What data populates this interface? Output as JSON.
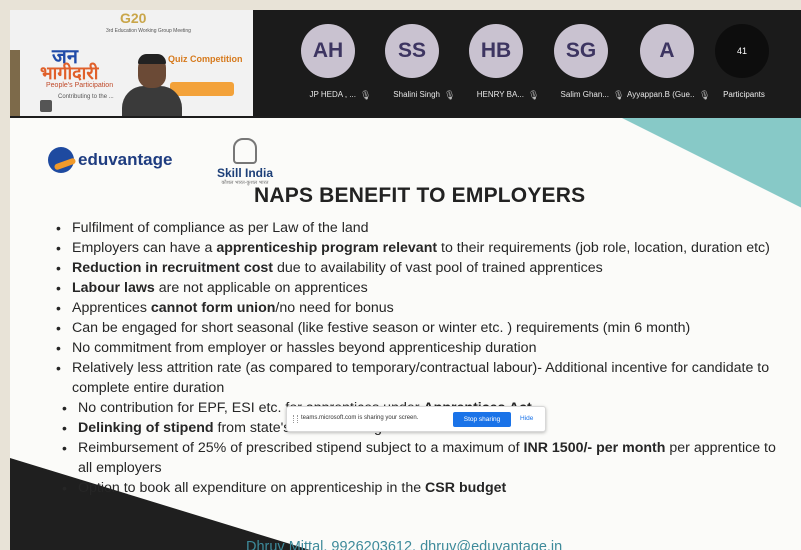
{
  "call": {
    "speaker_tile": {
      "g20_text": "G20",
      "sub_text": "3rd Education Working Group Meeting",
      "jan_text": "जन",
      "bhagidari_text": "भागीदारी",
      "participation_text": "People's Participation",
      "contributing_text": "Contributing to the ...",
      "quiz_text": "Quiz Competition"
    },
    "participants": [
      {
        "initials": "AH",
        "name": "JP HEDA , ..."
      },
      {
        "initials": "SS",
        "name": "Shalini Singh"
      },
      {
        "initials": "HB",
        "name": "HENRY BA..."
      },
      {
        "initials": "SG",
        "name": "Salim Ghan..."
      },
      {
        "initials": "A",
        "name": "Ayyappan.B (Gue..."
      }
    ],
    "participant_count": "41",
    "participants_label": "Participants",
    "mic_glyph": "🎙"
  },
  "slide": {
    "logo_text": "eduvantage",
    "skill_india": {
      "name": "Skill India",
      "tagline": "कौशल भारत-कुशल भारत"
    },
    "title": "NAPS BENEFIT TO EMPLOYERS",
    "bullets": [
      {
        "pre": "Fulfilment of compliance as per Law of the land",
        "bold": "",
        "post": ""
      },
      {
        "pre": "Employers can have a ",
        "bold": "apprenticeship program relevant",
        "post": " to their requirements (job role, location, duration etc)"
      },
      {
        "pre": "",
        "bold": "Reduction in recruitment cost",
        "post": " due to availability of vast pool of trained apprentices"
      },
      {
        "pre": "",
        "bold": "Labour laws",
        "post": " are not applicable on apprentices"
      },
      {
        "pre": "Apprentices ",
        "bold": "cannot form union",
        "post": "/no need for bonus"
      },
      {
        "pre": "Can be engaged for short seasonal (like festive season or winter etc. ) requirements (min 6 month)",
        "bold": "",
        "post": ""
      },
      {
        "pre": "No commitment from employer or hassles beyond apprenticeship duration",
        "bold": "",
        "post": ""
      },
      {
        "pre": "Relatively less attrition rate (as compared to temporary/contractual labour)- Additional incentive for candidate to complete entire duration",
        "bold": "",
        "post": ""
      },
      {
        "pre": "No contribution for EPF, ESI etc. for apprentices under ",
        "bold": "Apprentices Act.",
        "post": ""
      },
      {
        "pre": "",
        "bold": "Delinking of stipend",
        "post": " from state's minimum wages"
      },
      {
        "pre": "Reimbursement of 25% of prescribed stipend subject to a maximum of ",
        "bold": "INR 1500/- per month",
        "post": " per apprentice to all employers"
      },
      {
        "pre": "Option to book all expenditure on apprenticeship in the ",
        "bold": "CSR budget",
        "post": ""
      }
    ],
    "footer": "Dhruv Mittal, 9926203612, dhruv@eduvantage.in"
  },
  "share_bar": {
    "message": "teams.microsoft.com is sharing your screen.",
    "stop_label": "Stop sharing",
    "hide_label": "Hide"
  }
}
